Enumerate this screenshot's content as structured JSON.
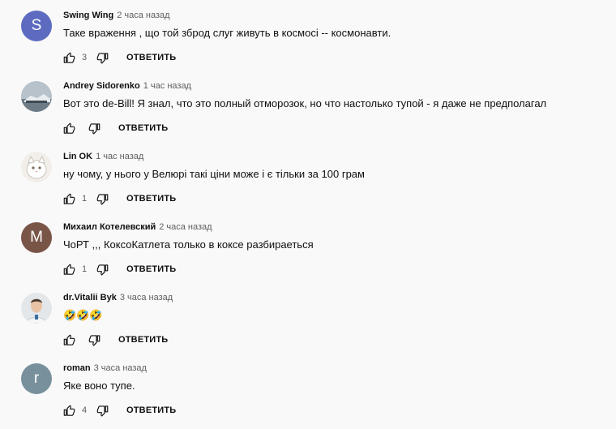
{
  "ui": {
    "reply_label": "ОТВЕТИТЬ"
  },
  "comments": [
    {
      "author": "Swing Wing",
      "time": "2 часа назад",
      "text": "Таке враження , що той зброд слуг живуть в космосі -- космонавти.",
      "likes": "3",
      "avatar": {
        "letter": "S",
        "color": "#5c6bc0"
      }
    },
    {
      "author": "Andrey Sidorenko",
      "time": "1 час назад",
      "text": "Вот это de-Bill! Я знал, что это полный отморозок, но что настолько тупой - я даже не предполагал",
      "likes": "",
      "avatar": {
        "letter": "",
        "color": "#9aa3ab"
      }
    },
    {
      "author": "Lin OK",
      "time": "1 час назад",
      "text": "ну чому, у нього у Велюрі такі ціни може і є тільки за 100 грам",
      "likes": "1",
      "avatar": {
        "letter": "",
        "color": "#e6e2dc"
      }
    },
    {
      "author": "Михаил Котелевский",
      "time": "2 часа назад",
      "text": "ЧоРТ ,,, КоксоКатлета только в коксе разбираеться",
      "likes": "1",
      "avatar": {
        "letter": "M",
        "color": "#795548"
      }
    },
    {
      "author": "dr.Vitalii Byk",
      "time": "3 часа назад",
      "text": "🤣🤣🤣",
      "likes": "",
      "avatar": {
        "letter": "",
        "color": "#dfe4e8"
      }
    },
    {
      "author": "roman",
      "time": "3 часа назад",
      "text": "Яке воно тупе.",
      "likes": "4",
      "avatar": {
        "letter": "r",
        "color": "#78909c"
      }
    }
  ]
}
